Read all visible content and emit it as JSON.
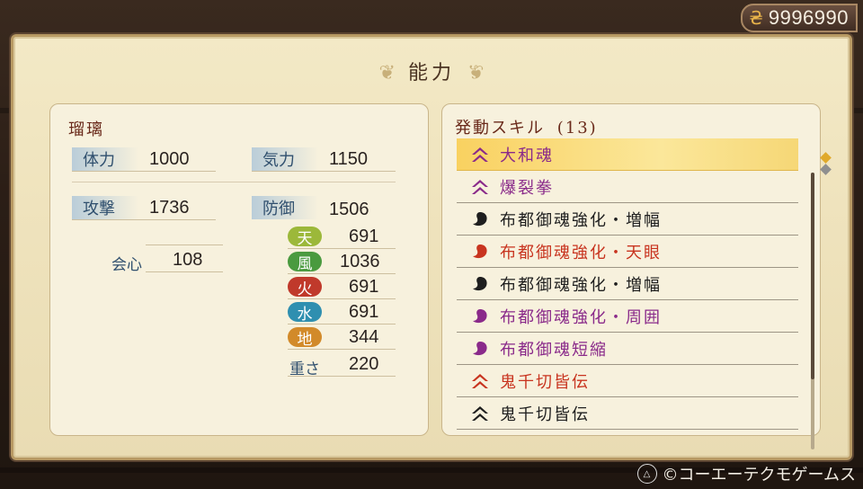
{
  "currency": {
    "icon": "coin-icon",
    "amount": "9996990"
  },
  "title": "能力",
  "character": {
    "name": "瑠璃",
    "stats": {
      "hp": {
        "label": "体力",
        "value": "1000"
      },
      "ki": {
        "label": "気力",
        "value": "1150"
      },
      "attack": {
        "label": "攻撃",
        "value": "1736"
      },
      "defense": {
        "label": "防御",
        "value": "1506"
      },
      "crit": {
        "label": "会心",
        "value": "108"
      }
    },
    "elements": [
      {
        "label": "天",
        "value": "691",
        "color": "#9cb83a"
      },
      {
        "label": "風",
        "value": "1036",
        "color": "#4a9a3f"
      },
      {
        "label": "火",
        "value": "691",
        "color": "#c0392b"
      },
      {
        "label": "水",
        "value": "691",
        "color": "#2f8fb0"
      },
      {
        "label": "地",
        "value": "344",
        "color": "#d28a2a"
      }
    ],
    "weight": {
      "label": "重さ",
      "value": "220"
    }
  },
  "skills": {
    "header": "発動スキル",
    "count": "(13)",
    "items": [
      {
        "label": "大和魂",
        "color": "#8a2a8a",
        "icon": "chevron-up-icon"
      },
      {
        "label": "爆裂拳",
        "color": "#8a2a8a",
        "icon": "chevron-up-icon"
      },
      {
        "label": "布都御魂強化・増幅",
        "color": "#1e1e1e",
        "icon": "comma-orb-icon"
      },
      {
        "label": "布都御魂強化・天眼",
        "color": "#c8341f",
        "icon": "comma-orb-icon"
      },
      {
        "label": "布都御魂強化・増幅",
        "color": "#1e1e1e",
        "icon": "comma-orb-icon"
      },
      {
        "label": "布都御魂強化・周囲",
        "color": "#8a2a8a",
        "icon": "comma-orb-icon"
      },
      {
        "label": "布都御魂短縮",
        "color": "#8a2a8a",
        "icon": "comma-orb-icon"
      },
      {
        "label": "鬼千切皆伝",
        "color": "#c8341f",
        "icon": "chevron-up-icon"
      },
      {
        "label": "鬼千切皆伝",
        "color": "#1e1e1e",
        "icon": "chevron-up-icon"
      }
    ]
  },
  "footer": {
    "button": "triangle-button-icon",
    "copyright": "©コーエーテクモゲームス"
  }
}
